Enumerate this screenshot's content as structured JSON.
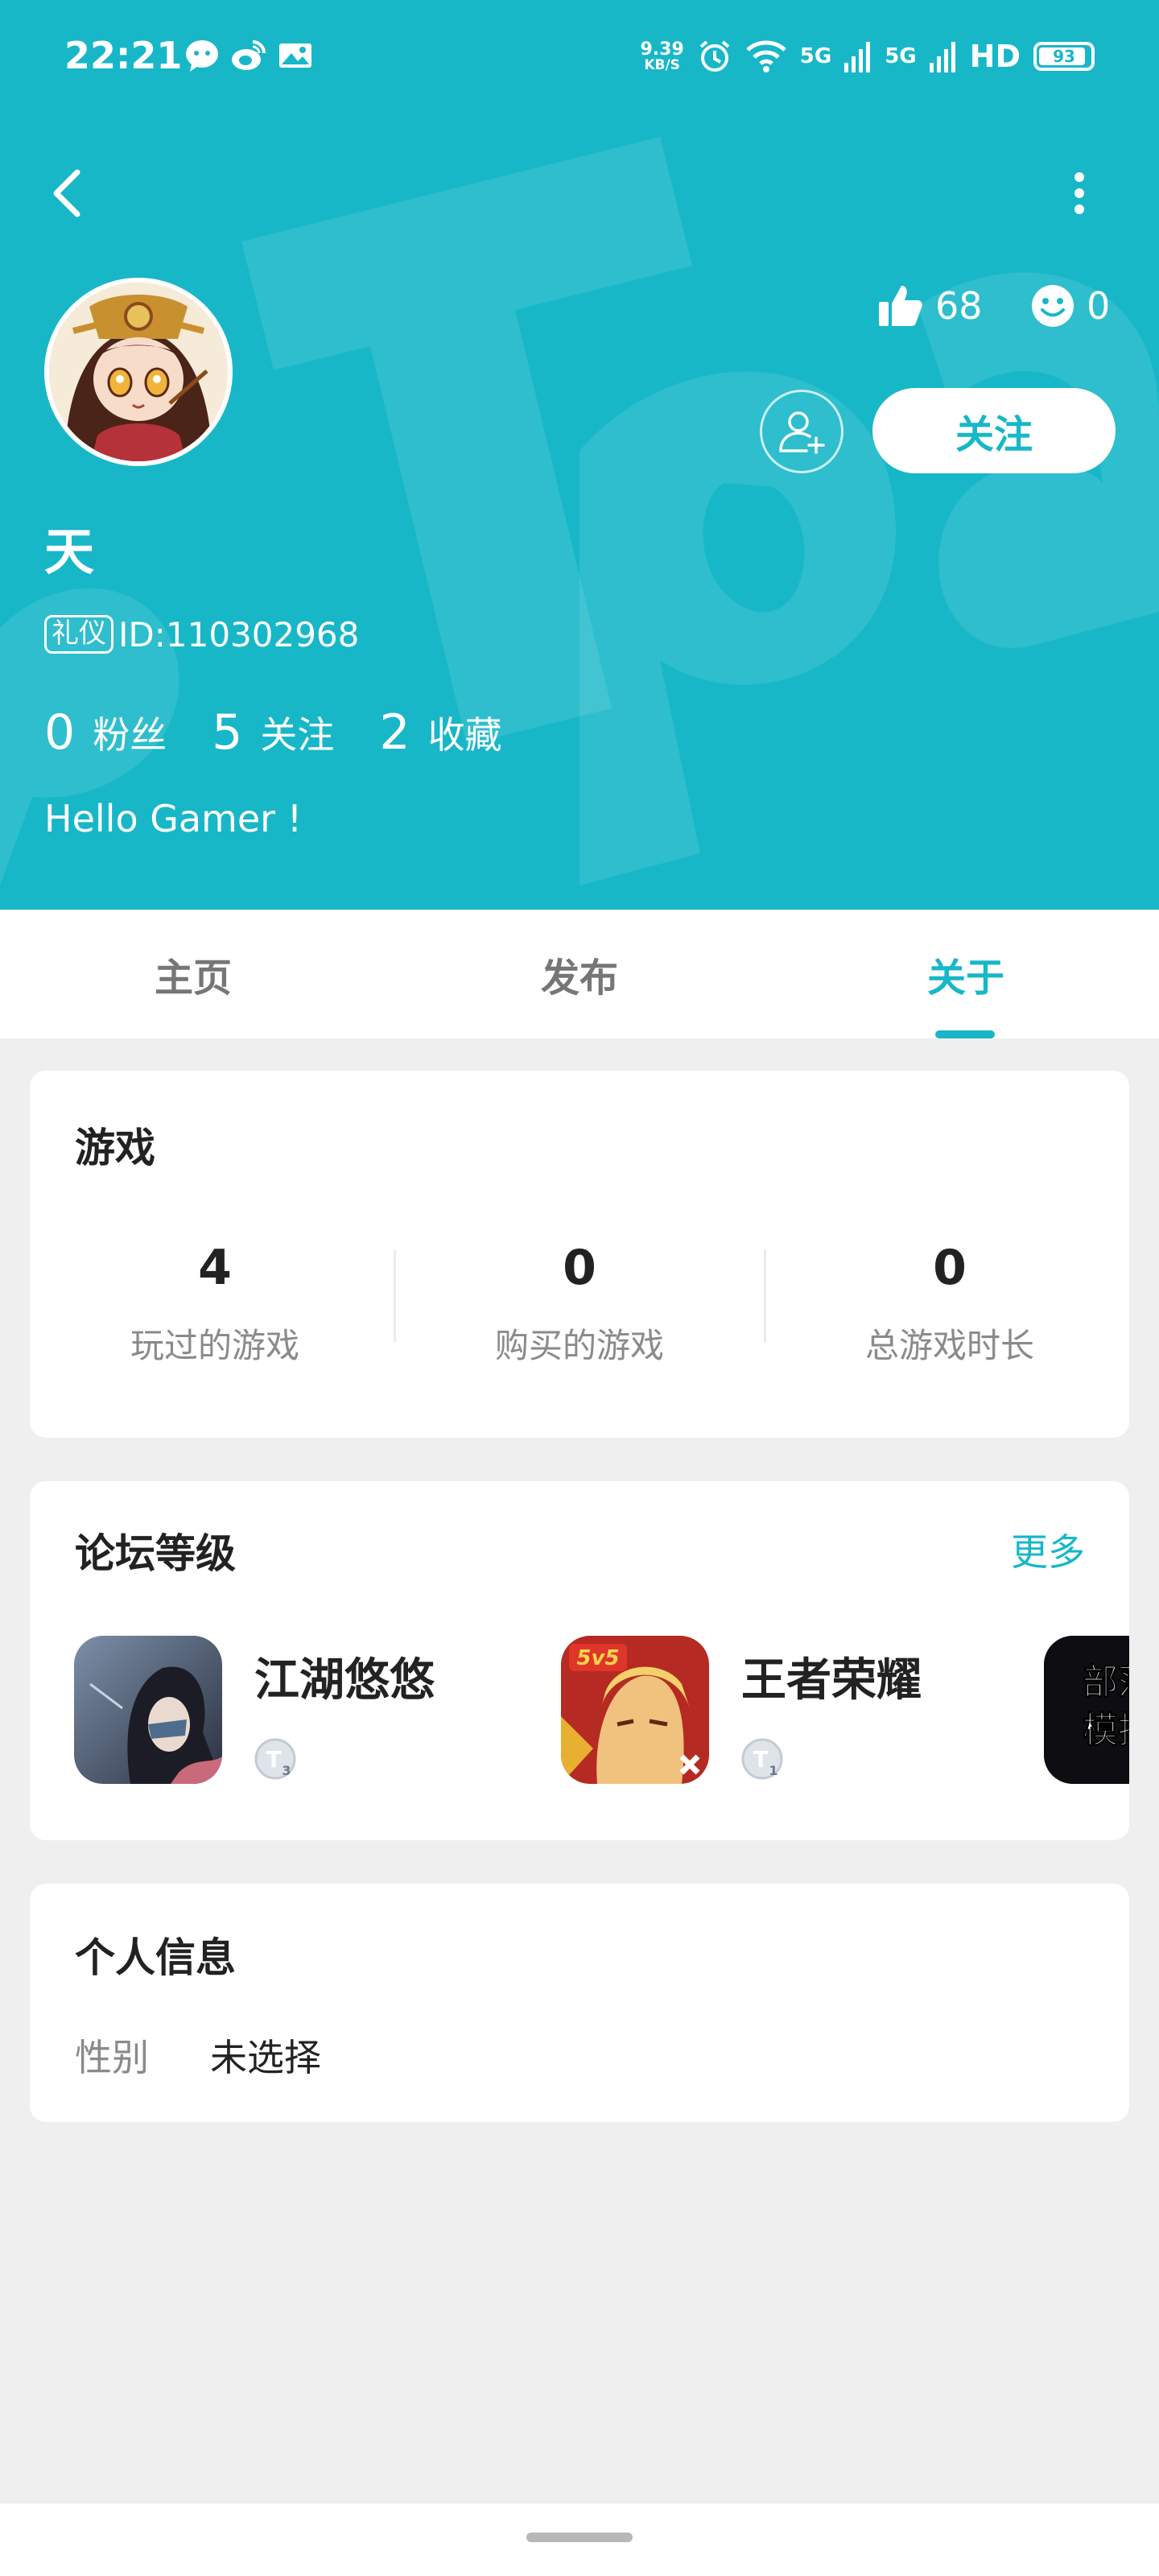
{
  "status_bar": {
    "time": "22:21",
    "notification_icons": [
      "wechat-icon",
      "weibo-icon",
      "mail-image-icon"
    ],
    "net_speed_value": "9.39",
    "net_speed_unit": "KB/S",
    "signal1_label": "5G",
    "signal2_label": "5G",
    "hd_label": "HD",
    "battery": "93",
    "battery_level": 0.93
  },
  "profile": {
    "likes": "68",
    "smiles": "0",
    "follow_label": "关注",
    "username": "天",
    "badge": "礼仪",
    "id_text": "ID:110302968",
    "counts": [
      {
        "num": "0",
        "label": "粉丝"
      },
      {
        "num": "5",
        "label": "关注"
      },
      {
        "num": "2",
        "label": "收藏"
      }
    ],
    "bio": "Hello Gamer !"
  },
  "tabs": {
    "home": "主页",
    "posts": "发布",
    "about": "关于",
    "active": "about"
  },
  "games": {
    "title": "游戏",
    "stats": [
      {
        "num": "4",
        "label": "玩过的游戏"
      },
      {
        "num": "0",
        "label": "购买的游戏"
      },
      {
        "num": "0",
        "label": "总游戏时长"
      }
    ]
  },
  "forum": {
    "title": "论坛等级",
    "more": "更多",
    "items": [
      {
        "name": "江湖悠悠",
        "level": "3",
        "icon_text": ""
      },
      {
        "name": "王者荣耀",
        "level": "1",
        "icon_text": "5v5"
      },
      {
        "name": "",
        "level": "",
        "icon_text": "部落模拟"
      }
    ]
  },
  "personal": {
    "title": "个人信息",
    "gender_label": "性别",
    "gender_value": "未选择"
  },
  "colors": {
    "accent": "#17b7c8",
    "background": "#efefef",
    "card": "#ffffff",
    "text_primary": "#222222",
    "text_secondary": "#8a8a8a"
  }
}
